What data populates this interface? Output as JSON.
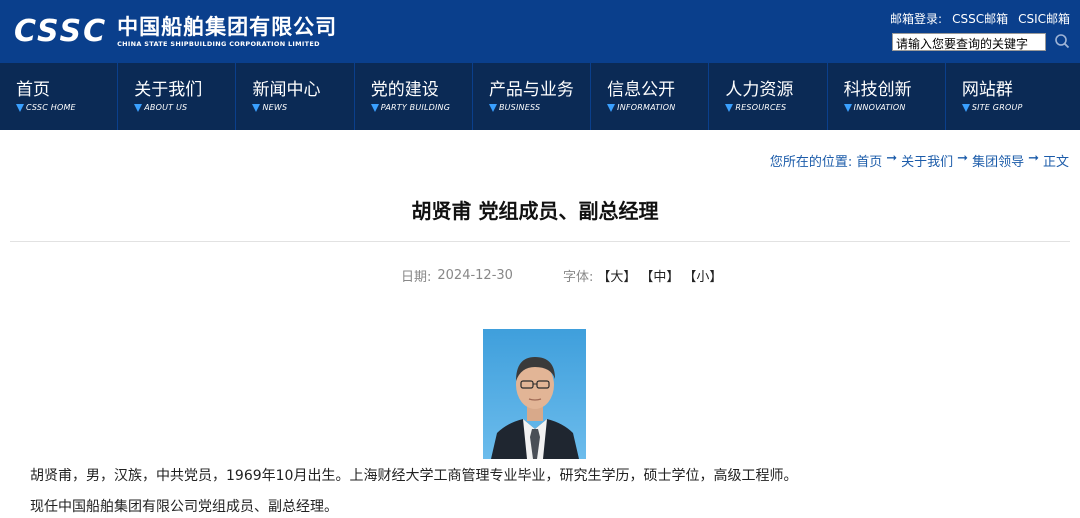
{
  "header": {
    "logo_mark": "CSSC",
    "logo_cn": "中国船舶集团有限公司",
    "logo_en": "CHINA STATE SHIPBUILDING CORPORATION LIMITED",
    "mail_label": "邮箱登录:",
    "mail_links": [
      "CSSC邮箱",
      "CSIC邮箱"
    ],
    "search_placeholder": "请输入您要查询的关键字",
    "brand_color": "#0a3f8c"
  },
  "nav": [
    {
      "cn": "首页",
      "en": "CSSC HOME"
    },
    {
      "cn": "关于我们",
      "en": "ABOUT US"
    },
    {
      "cn": "新闻中心",
      "en": "NEWS"
    },
    {
      "cn": "党的建设",
      "en": "PARTY BUILDING"
    },
    {
      "cn": "产品与业务",
      "en": "BUSINESS"
    },
    {
      "cn": "信息公开",
      "en": "INFORMATION"
    },
    {
      "cn": "人力资源",
      "en": "RESOURCES"
    },
    {
      "cn": "科技创新",
      "en": "INNOVATION"
    },
    {
      "cn": "网站群",
      "en": "SITE GROUP"
    }
  ],
  "breadcrumb": {
    "prefix": "您所在的位置:",
    "items": [
      "首页",
      "关于我们",
      "集团领导",
      "正文"
    ],
    "separator": "➞"
  },
  "article": {
    "title": "胡贤甫 党组成员、副总经理",
    "date_label": "日期:",
    "date": "2024-12-30",
    "font_label": "字体:",
    "font_options": [
      "【大】",
      "【中】",
      "【小】"
    ],
    "paragraphs": [
      "胡贤甫，男，汉族，中共党员，1969年10月出生。上海财经大学工商管理专业毕业，研究生学历，硕士学位，高级工程师。",
      "现任中国船舶集团有限公司党组成员、副总经理。"
    ]
  }
}
